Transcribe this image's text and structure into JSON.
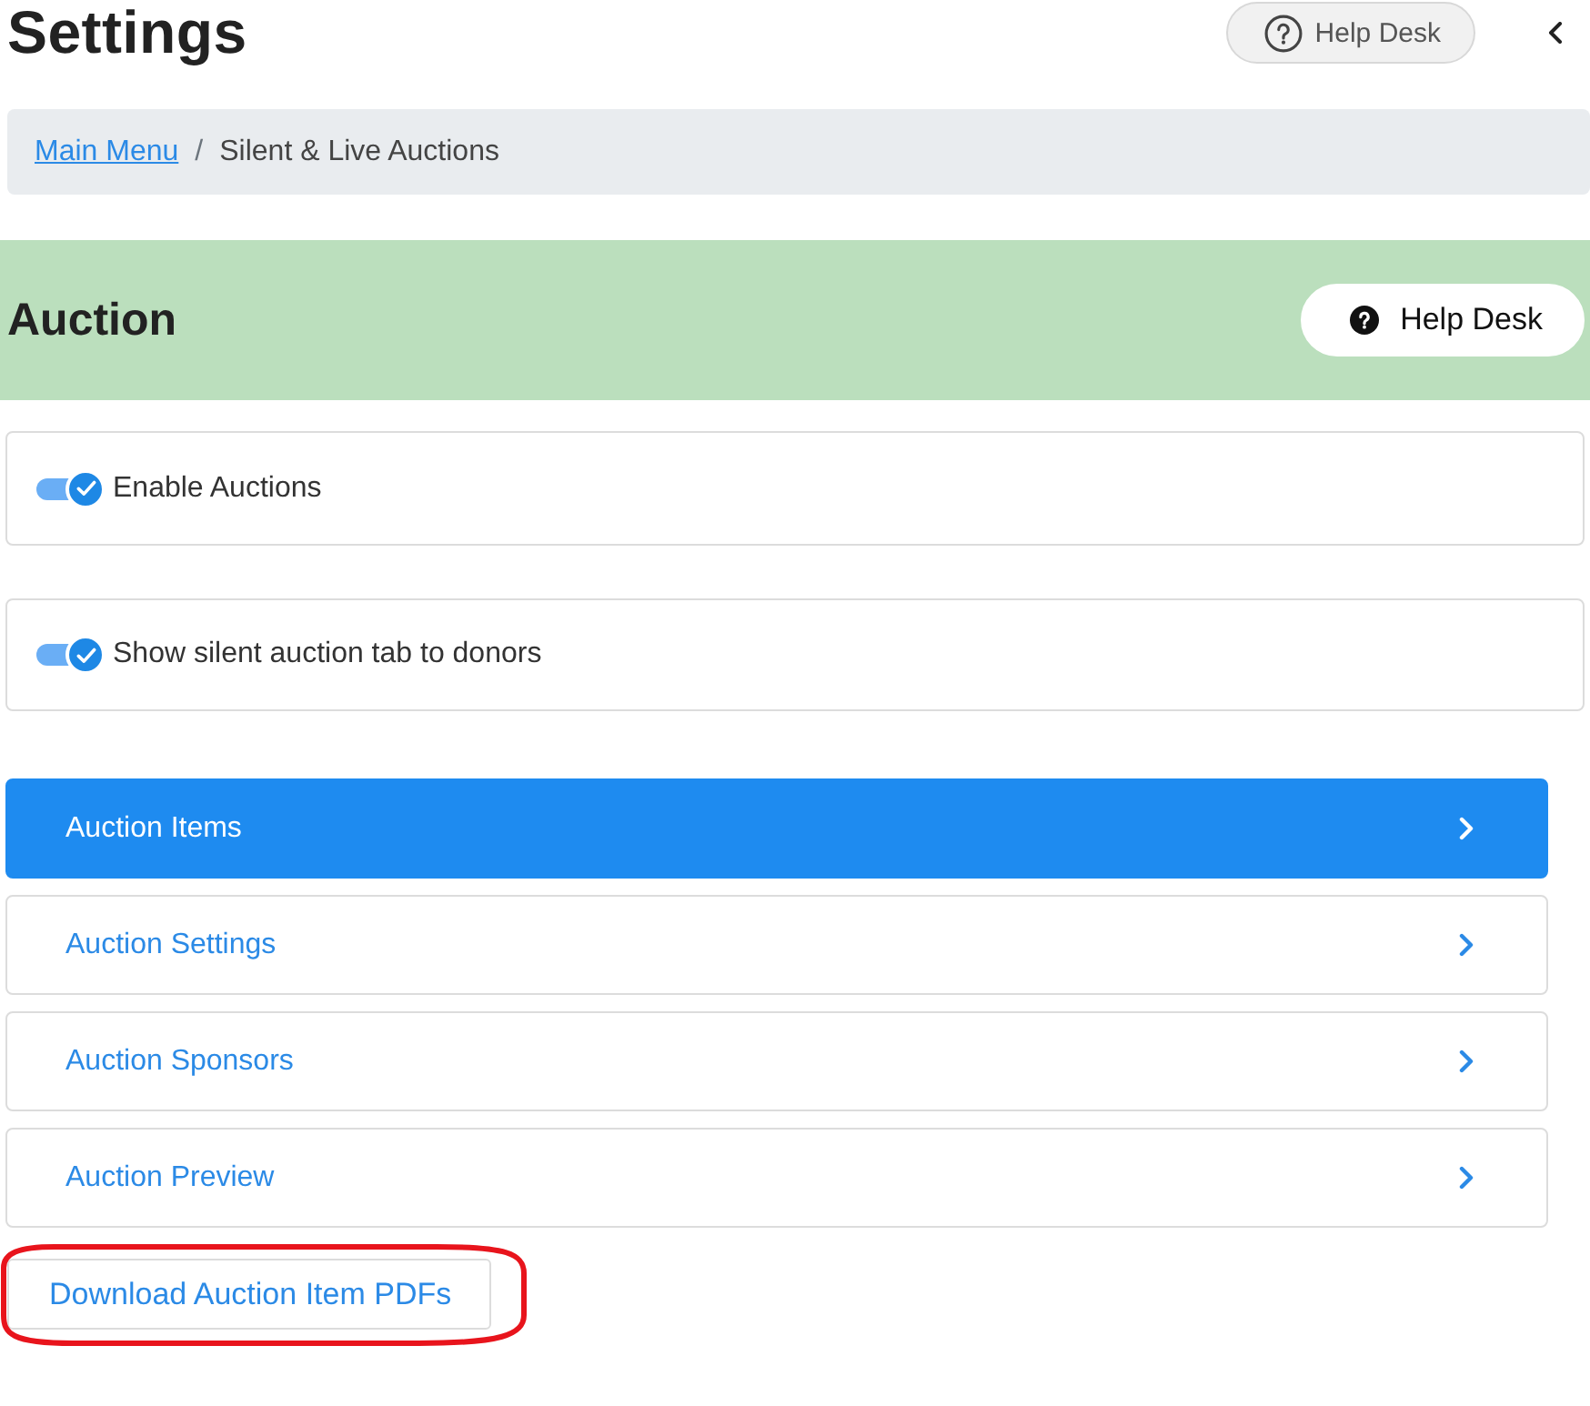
{
  "header": {
    "title": "Settings",
    "help_button": "Help Desk"
  },
  "breadcrumb": {
    "items": [
      {
        "label": "Main Menu",
        "kind": "link"
      },
      {
        "label": "Silent & Live Auctions",
        "kind": "current"
      }
    ],
    "separator": "/"
  },
  "section": {
    "title": "Auction",
    "help_button": "Help Desk"
  },
  "toggles": [
    {
      "label": "Enable Auctions",
      "checked": true
    },
    {
      "label": "Show silent auction tab to donors",
      "checked": true
    }
  ],
  "menu": [
    {
      "label": "Auction Items",
      "selected": true
    },
    {
      "label": "Auction Settings",
      "selected": false
    },
    {
      "label": "Auction Sponsors",
      "selected": false
    },
    {
      "label": "Auction Preview",
      "selected": false
    }
  ],
  "download_button": {
    "label": "Download Auction Item PDFs",
    "circled": true
  }
}
